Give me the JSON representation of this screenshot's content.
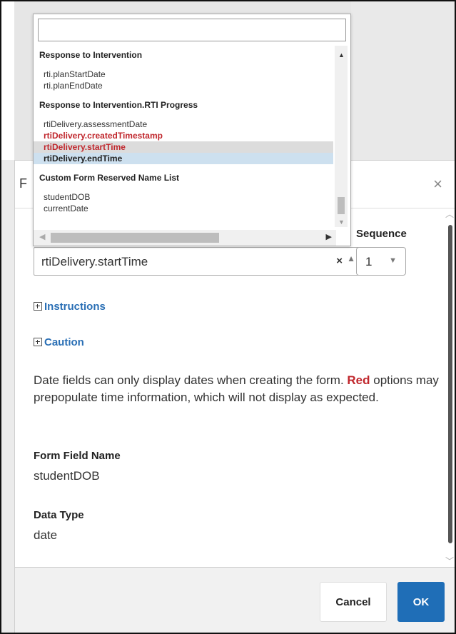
{
  "modal": {
    "title_fragment": "F",
    "close_label": "×",
    "sequence_label": "Sequence",
    "field_value": "rtiDelivery.startTime",
    "clear_glyph": "×",
    "caret_up": "▲",
    "sequence_value": "1",
    "sequence_caret": "▼",
    "instructions_label": "Instructions",
    "caution_label": "Caution",
    "caution_text_before": "Date fields can only display dates when creating the form. ",
    "caution_text_red": "Red",
    "caution_text_after": " options may prepopulate time information, which will not display as expected.",
    "form_field_name_label": "Form Field Name",
    "form_field_name_value": "studentDOB",
    "data_type_label": "Data Type",
    "data_type_value": "date",
    "cancel_label": "Cancel",
    "ok_label": "OK"
  },
  "dropdown": {
    "search_value": "",
    "groups": [
      {
        "label": "Response to Intervention",
        "items": [
          {
            "text": "rti.planStartDate",
            "style": "normal"
          },
          {
            "text": "rti.planEndDate",
            "style": "normal"
          }
        ]
      },
      {
        "label": "Response to Intervention.RTI Progress",
        "items": [
          {
            "text": "rtiDelivery.assessmentDate",
            "style": "normal"
          },
          {
            "text": "rtiDelivery.createdTimestamp",
            "style": "red"
          },
          {
            "text": "rtiDelivery.startTime",
            "style": "red-selected"
          },
          {
            "text": "rtiDelivery.endTime",
            "style": "highlighted"
          }
        ]
      },
      {
        "label": "Custom Form Reserved Name List",
        "items": [
          {
            "text": "studentDOB",
            "style": "normal"
          },
          {
            "text": "currentDate",
            "style": "normal"
          }
        ]
      }
    ]
  },
  "colors": {
    "accent": "#1f6eb7",
    "link": "#2a6fb5",
    "warning_red": "#c0272d",
    "highlight_blue": "#cde0ef",
    "selected_gray": "#dcdcdc"
  }
}
